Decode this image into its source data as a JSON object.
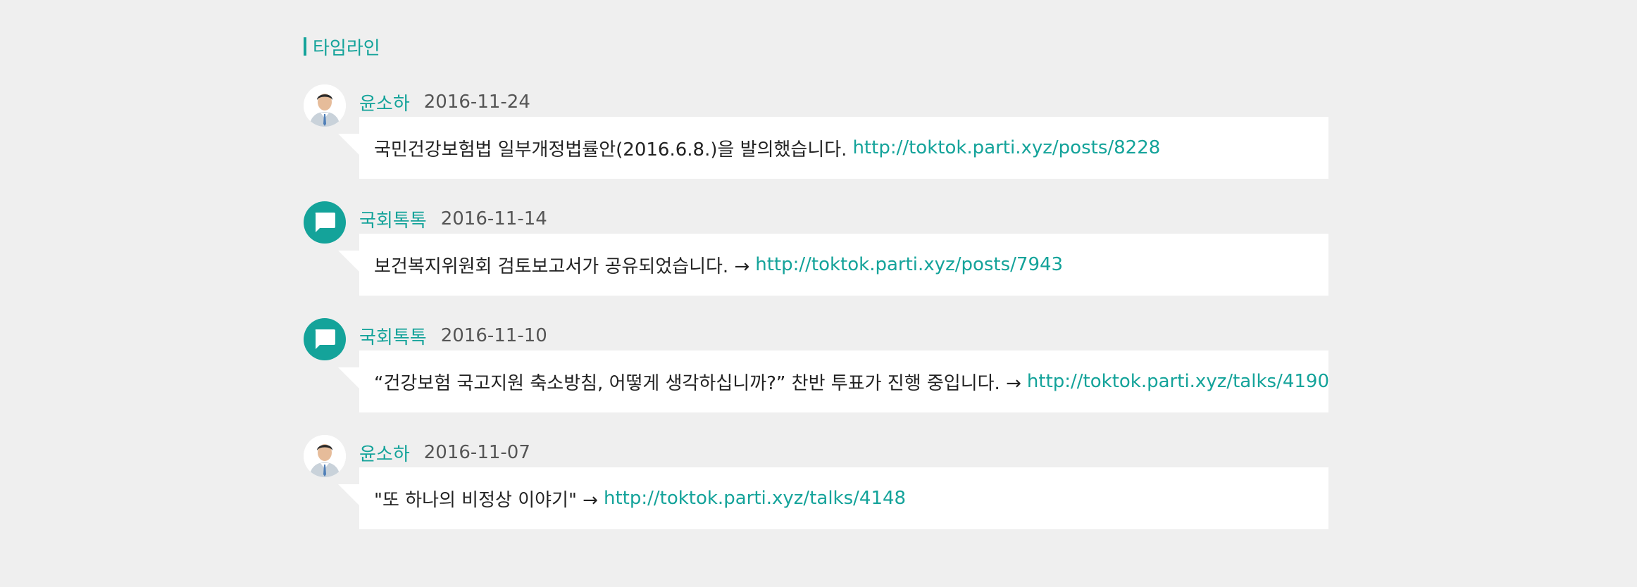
{
  "section": {
    "title": "타임라인"
  },
  "colors": {
    "accent": "#14a39a",
    "background": "#efefef",
    "bubble": "#ffffff",
    "text": "#222222",
    "date": "#555555"
  },
  "entries": [
    {
      "author": "윤소하",
      "date": "2016-11-24",
      "avatar_type": "photo",
      "avatar_icon": "person-photo",
      "text": "국민건강보험법 일부개정법률안(2016.6.8.)을 발의했습니다.",
      "link": "http://toktok.parti.xyz/posts/8228"
    },
    {
      "author": "국회톡톡",
      "date": "2016-11-14",
      "avatar_type": "talk",
      "avatar_icon": "chat-bubble-icon",
      "text": "보건복지위원회 검토보고서가 공유되었습니다. →",
      "link": "http://toktok.parti.xyz/posts/7943"
    },
    {
      "author": "국회톡톡",
      "date": "2016-11-10",
      "avatar_type": "talk",
      "avatar_icon": "chat-bubble-icon",
      "text": "“건강보험 국고지원 축소방침, 어떻게 생각하십니까?” 찬반 투표가 진행 중입니다. →",
      "link": "http://toktok.parti.xyz/talks/4190"
    },
    {
      "author": "윤소하",
      "date": "2016-11-07",
      "avatar_type": "photo",
      "avatar_icon": "person-photo",
      "text": "\"또 하나의 비정상 이야기\" →",
      "link": "http://toktok.parti.xyz/talks/4148"
    }
  ]
}
